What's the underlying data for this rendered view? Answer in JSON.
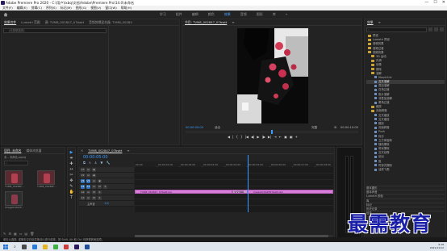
{
  "window": {
    "title": "Adobe Premiere Pro 2020 - C:\\用户\\Ixbq\\文档\\Adobe\\Premiere Pro\\14.0\\未命名",
    "min": "—",
    "max": "☐",
    "close": "✕"
  },
  "menu": [
    "文件(F)",
    "编辑(E)",
    "剪辑(C)",
    "序列(S)",
    "标记(M)",
    "图形(G)",
    "视图(V)",
    "窗口(W)",
    "帮助(H)"
  ],
  "workspaces": {
    "items": [
      "学习",
      "组件",
      "编辑",
      "颜色",
      "效果",
      "音频",
      "图形",
      "库"
    ],
    "active": "效果",
    "more": "»"
  },
  "source_panel": {
    "tabs": [
      "效果控件",
      "Lumetri 范围",
      "源: TVM8_002847_07bwtt",
      "音频剪辑混合器: TVM8_00284"
    ],
    "active_tab": "效果控件",
    "menu_icon": "≡",
    "search_placeholder": "(无剪辑选择)"
  },
  "program_monitor": {
    "title": "节目: TVM8_002847_07bwtt",
    "menu_icon": "≡",
    "timecode_left": "00:00:00:00",
    "fit": "适合",
    "quality": "完整",
    "timecode_right": "00:00:10:00",
    "controls": [
      "◀",
      "|",
      "{",
      "}",
      "|◀",
      "◀|",
      "▶",
      "|▶",
      "▶|",
      "⇥",
      "⇤",
      "▣",
      "▣",
      "+"
    ]
  },
  "project_panel": {
    "tabs": [
      "项目: 未命名",
      "媒体浏览器"
    ],
    "active_tab": "项目: 未命名",
    "subtitle": "未... 未命名.prproj",
    "items": [
      {
        "name": "TVM8_00284F...",
        "dur": "5:00"
      },
      {
        "name": "TVM8_00284F...",
        "dur": "5:00"
      },
      {
        "name": "Image01002F...",
        "dur": "5:00"
      }
    ],
    "footer": "1 项已选择, 共 3 项"
  },
  "timeline": {
    "tab": "TVM8_002847_07bwtt",
    "menu_icon": "≡",
    "timecode": "00:00:05:00",
    "ruler_labels": [
      "00:00",
      "00:00:01:00",
      "00:00:02:00",
      "00:00:03:00",
      "00:00:04:00",
      "00:00:05:00",
      "00:00:06:00",
      "00:00:07:00",
      "00:00:08:00"
    ],
    "video_tracks": [
      {
        "id": "V3",
        "toggles": [
          "V3",
          "⊡",
          "◉"
        ]
      },
      {
        "id": "V2",
        "toggles": [
          "V2",
          "⊡",
          "◉"
        ]
      },
      {
        "id": "V1",
        "toggles": [
          "V1",
          "⊡",
          "◉"
        ],
        "source": "V1"
      }
    ],
    "audio_tracks": [
      {
        "id": "A1",
        "toggles": [
          "A1",
          "⊡",
          "M",
          "S"
        ],
        "source": "A1"
      },
      {
        "id": "A2",
        "toggles": [
          "A2",
          "⊡",
          "M",
          "S"
        ]
      },
      {
        "id": "A3",
        "toggles": [
          "A3",
          "⊡",
          "M",
          "S"
        ]
      }
    ],
    "master": {
      "label": "主声道",
      "value": "0.0"
    },
    "clips": [
      {
        "label": "TVM8_002847_07bwtt.jpg",
        "track": "V1",
        "start": 0.0,
        "end": 4.33
      },
      {
        "label": "交叉溶解",
        "track": "V1",
        "start": 4.33,
        "end": 5.0
      },
      {
        "label": "image01002F67bwtt.jpg",
        "track": "V1",
        "start": 5.0,
        "end": 10.0
      }
    ],
    "playhead_seconds": 5.0,
    "range_seconds": [
      0,
      8.8
    ]
  },
  "tools": [
    "▶",
    "⇼",
    "✚",
    "↔",
    "✂",
    "✥",
    "✎",
    "✋",
    "T"
  ],
  "effects_panel": {
    "title": "效果",
    "menu_icon": "≡",
    "search_placeholder": "",
    "items": [
      {
        "label": "预设",
        "type": "folder",
        "indent": 0
      },
      {
        "label": "Lumetri 预设",
        "type": "folder",
        "indent": 0
      },
      {
        "label": "音频效果",
        "type": "folder",
        "indent": 0
      },
      {
        "label": "音频过渡",
        "type": "folder",
        "indent": 0
      },
      {
        "label": "视频效果",
        "type": "folder",
        "indent": 0
      },
      {
        "label": "3D 运动",
        "type": "folder",
        "indent": 1
      },
      {
        "label": "内滑",
        "type": "folder",
        "indent": 1
      },
      {
        "label": "划像",
        "type": "folder",
        "indent": 1
      },
      {
        "label": "擦除",
        "type": "folder",
        "indent": 1
      },
      {
        "label": "溶解",
        "type": "folder",
        "indent": 1
      },
      {
        "label": "MorphCut",
        "type": "fx",
        "indent": 2
      },
      {
        "label": "交叉溶解",
        "type": "fx",
        "indent": 2
      },
      {
        "label": "叠加溶解",
        "type": "fx",
        "indent": 2
      },
      {
        "label": "白场过渡",
        "type": "fx",
        "indent": 2
      },
      {
        "label": "胶片溶解",
        "type": "fx",
        "indent": 2
      },
      {
        "label": "非叠加溶解",
        "type": "fx",
        "indent": 2
      },
      {
        "label": "黑场过渡",
        "type": "fx",
        "indent": 2
      },
      {
        "label": "缩放",
        "type": "folder",
        "indent": 1
      },
      {
        "label": "页面剥落",
        "type": "folder",
        "indent": 1
      },
      {
        "label": "交叉缩放",
        "type": "fx",
        "indent": 2
      },
      {
        "label": "交叉缩放",
        "type": "fx",
        "indent": 2
      },
      {
        "label": "翻页",
        "type": "fx",
        "indent": 2
      },
      {
        "label": "页面剥落",
        "type": "fx",
        "indent": 2
      },
      {
        "label": "Push",
        "type": "fx",
        "indent": 2
      },
      {
        "label": "拆分",
        "type": "fx",
        "indent": 2
      },
      {
        "label": "立方体旋转",
        "type": "fx",
        "indent": 2
      },
      {
        "label": "随机擦除",
        "type": "fx",
        "indent": 2
      },
      {
        "label": "带状擦除",
        "type": "fx",
        "indent": 2
      },
      {
        "label": "交叉划像",
        "type": "fx",
        "indent": 2
      },
      {
        "label": "划出",
        "type": "fx",
        "indent": 2
      },
      {
        "label": "推",
        "type": "fx",
        "indent": 2
      },
      {
        "label": "时钟式擦除",
        "type": "fx",
        "indent": 2
      },
      {
        "label": "油漆飞溅",
        "type": "fx",
        "indent": 2
      }
    ],
    "selected": "交叉溶解",
    "sections": [
      "基本图形",
      "基本声音",
      "Lumetri 颜色",
      "库",
      "标记",
      "历史记录",
      "信息"
    ]
  },
  "status_bar": {
    "text": "单击以选择, 或单击空白处并拖动以进行选择。按 Shift, Alt 和 Ctrl 可获得其他选项。"
  },
  "taskbar": {
    "time": "9:18",
    "date": "2021/11/12"
  },
  "watermark": "最需教育",
  "colors": {
    "accent": "#3b9bff",
    "clip": "#d77ed9",
    "playhead": "#3b9bff",
    "watermark": "#1a1fa8"
  }
}
